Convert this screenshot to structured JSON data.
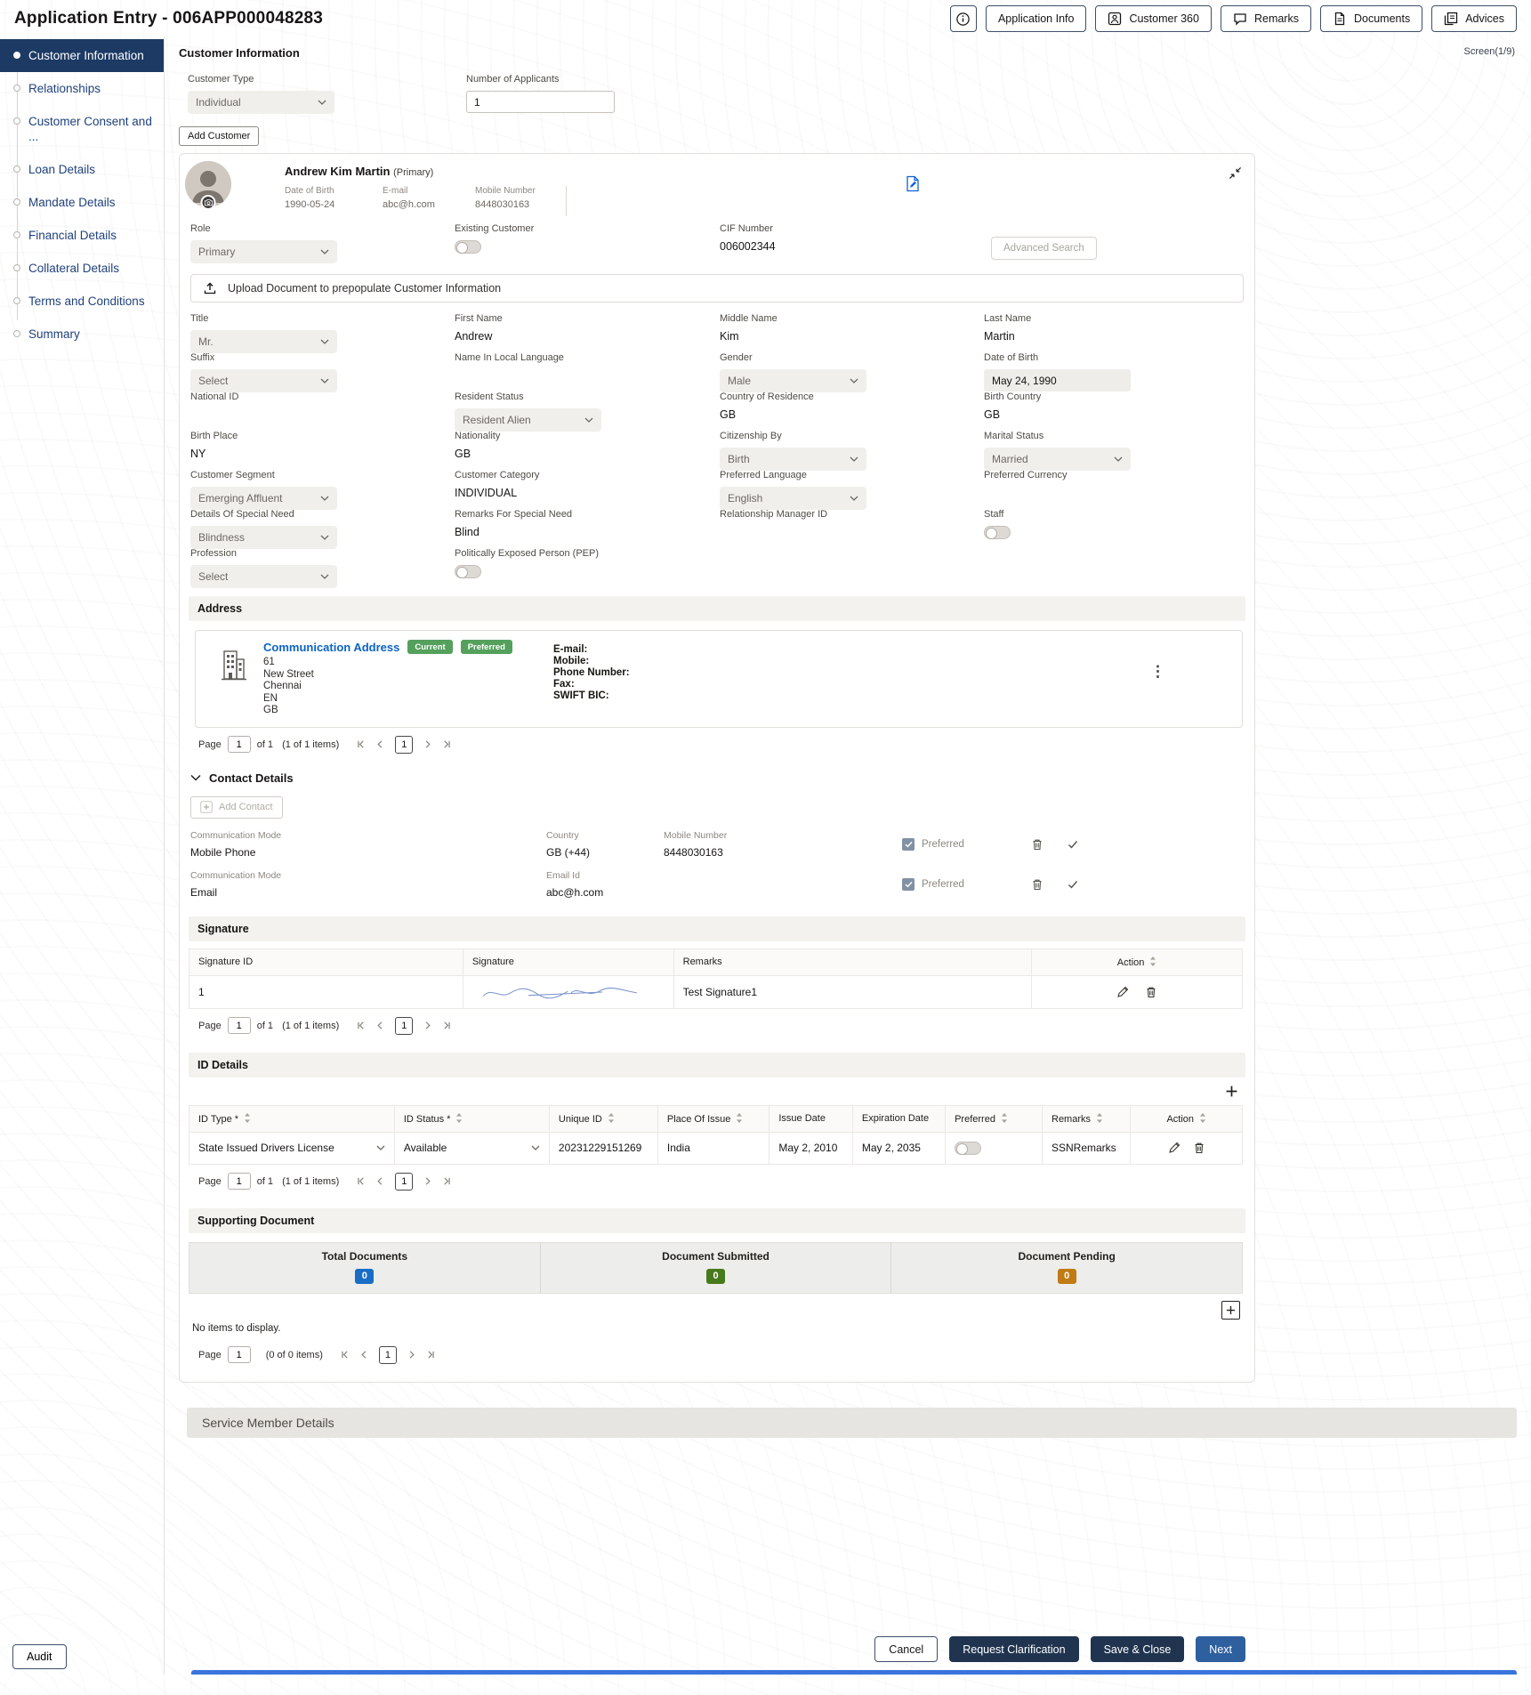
{
  "header": {
    "title": "Application Entry - 006APP000048283",
    "buttons": {
      "application_info": "Application Info",
      "customer_360": "Customer 360",
      "remarks": "Remarks",
      "documents": "Documents",
      "advices": "Advices"
    }
  },
  "sidebar": {
    "items": [
      {
        "label": "Customer Information"
      },
      {
        "label": "Relationships"
      },
      {
        "label": "Customer Consent and ..."
      },
      {
        "label": "Loan Details"
      },
      {
        "label": "Mandate Details"
      },
      {
        "label": "Financial Details"
      },
      {
        "label": "Collateral Details"
      },
      {
        "label": "Terms and Conditions"
      },
      {
        "label": "Summary"
      }
    ]
  },
  "page": {
    "title": "Customer Information",
    "screen_indicator": "Screen(1/9)"
  },
  "applicants": {
    "customer_type_label": "Customer Type",
    "customer_type_value": "Individual",
    "number_label": "Number of Applicants",
    "number_value": "1",
    "add_customer_label": "Add Customer"
  },
  "customer_card": {
    "name": "Andrew Kim Martin",
    "role_suffix": "(Primary)",
    "dob_label": "Date of Birth",
    "dob_value": "1990-05-24",
    "email_label": "E-mail",
    "email_value": "abc@h.com",
    "mobile_label": "Mobile Number",
    "mobile_value": "8448030163",
    "role_label": "Role",
    "role_value": "Primary",
    "existing_customer_label": "Existing Customer",
    "cif_label": "CIF Number",
    "cif_value": "006002344",
    "advanced_search_label": "Advanced Search",
    "upload_label": "Upload Document to prepopulate Customer Information"
  },
  "form": {
    "title": {
      "label": "Title",
      "value": "Mr."
    },
    "first_name": {
      "label": "First Name",
      "value": "Andrew"
    },
    "middle_name": {
      "label": "Middle Name",
      "value": "Kim"
    },
    "last_name": {
      "label": "Last Name",
      "value": "Martin"
    },
    "suffix": {
      "label": "Suffix",
      "value": "Select"
    },
    "local_name": {
      "label": "Name In Local Language",
      "value": ""
    },
    "gender": {
      "label": "Gender",
      "value": "Male"
    },
    "dob": {
      "label": "Date of Birth",
      "value": "May 24, 1990"
    },
    "national_id": {
      "label": "National ID",
      "value": ""
    },
    "resident_status": {
      "label": "Resident Status",
      "value": "Resident Alien"
    },
    "country_of_residence": {
      "label": "Country of Residence",
      "value": "GB"
    },
    "birth_country": {
      "label": "Birth Country",
      "value": "GB"
    },
    "birth_place": {
      "label": "Birth Place",
      "value": "NY"
    },
    "nationality": {
      "label": "Nationality",
      "value": "GB"
    },
    "citizenship_by": {
      "label": "Citizenship By",
      "value": "Birth"
    },
    "marital_status": {
      "label": "Marital Status",
      "value": "Married"
    },
    "customer_segment": {
      "label": "Customer Segment",
      "value": "Emerging Affluent"
    },
    "customer_category": {
      "label": "Customer Category",
      "value": "INDIVIDUAL"
    },
    "preferred_language": {
      "label": "Preferred Language",
      "value": "English"
    },
    "preferred_currency": {
      "label": "Preferred Currency",
      "value": ""
    },
    "special_need": {
      "label": "Details Of Special Need",
      "value": "Blindness"
    },
    "special_need_remarks": {
      "label": "Remarks For Special Need",
      "value": "Blind"
    },
    "rm_id": {
      "label": "Relationship Manager ID",
      "value": ""
    },
    "staff": {
      "label": "Staff"
    },
    "profession": {
      "label": "Profession",
      "value": "Select"
    },
    "pep": {
      "label": "Politically Exposed Person (PEP)"
    }
  },
  "address": {
    "section_title": "Address",
    "card_title": "Communication Address",
    "badges": [
      "Current",
      "Preferred"
    ],
    "lines": [
      "61",
      "New Street",
      "Chennai",
      "EN",
      "GB"
    ],
    "contact_labels": [
      "E-mail:",
      "Mobile:",
      "Phone Number:",
      "Fax:",
      "SWIFT BIC:"
    ],
    "pagination": {
      "page_label": "Page",
      "page_value": "1",
      "of_text": "of 1",
      "items_text": "(1 of 1 items)",
      "nav_page": "1"
    }
  },
  "contact_details": {
    "section_title": "Contact Details",
    "add_contact_label": "Add Contact",
    "rows": [
      {
        "mode_label": "Communication Mode",
        "mode_value": "Mobile Phone",
        "col2_label": "Country",
        "col2_value": "GB (+44)",
        "col3_label": "Mobile Number",
        "col3_value": "8448030163",
        "preferred_label": "Preferred"
      },
      {
        "mode_label": "Communication Mode",
        "mode_value": "Email",
        "col2_label": "Email Id",
        "col2_value": "abc@h.com",
        "col3_label": "",
        "col3_value": "",
        "preferred_label": "Preferred"
      }
    ]
  },
  "signature": {
    "section_title": "Signature",
    "headers": [
      "Signature ID",
      "Signature",
      "Remarks",
      "Action"
    ],
    "rows": [
      {
        "id": "1",
        "remarks": "Test Signature1"
      }
    ],
    "pagination": {
      "page_label": "Page",
      "page_value": "1",
      "of_text": "of 1",
      "items_text": "(1 of 1 items)",
      "nav_page": "1"
    }
  },
  "id_details": {
    "section_title": "ID Details",
    "headers": [
      "ID Type *",
      "ID Status *",
      "Unique ID",
      "Place Of Issue",
      "Issue Date",
      "Expiration Date",
      "Preferred",
      "Remarks",
      "Action"
    ],
    "row": {
      "id_type": "State Issued Drivers License",
      "id_status": "Available",
      "unique_id": "20231229151269",
      "place_of_issue": "India",
      "issue_date": "May 2, 2010",
      "expiration_date": "May 2, 2035",
      "remarks": "SSNRemarks"
    },
    "pagination": {
      "page_label": "Page",
      "page_value": "1",
      "of_text": "of 1",
      "items_text": "(1 of 1 items)",
      "nav_page": "1"
    }
  },
  "supporting_document": {
    "section_title": "Supporting Document",
    "stats": [
      {
        "label": "Total Documents",
        "value": "0",
        "color": "#1a6dc4"
      },
      {
        "label": "Document Submitted",
        "value": "0",
        "color": "#47791d"
      },
      {
        "label": "Document Pending",
        "value": "0",
        "color": "#c07b14"
      }
    ],
    "empty_text": "No items to display.",
    "pagination": {
      "page_label": "Page",
      "page_value": "1",
      "of_text": "",
      "items_text": "(0 of 0 items)",
      "nav_page": "1"
    }
  },
  "service_member": {
    "title": "Service Member Details"
  },
  "footer": {
    "audit_label": "Audit",
    "cancel_label": "Cancel",
    "request_clarification_label": "Request Clarification",
    "save_close_label": "Save & Close",
    "next_label": "Next"
  }
}
